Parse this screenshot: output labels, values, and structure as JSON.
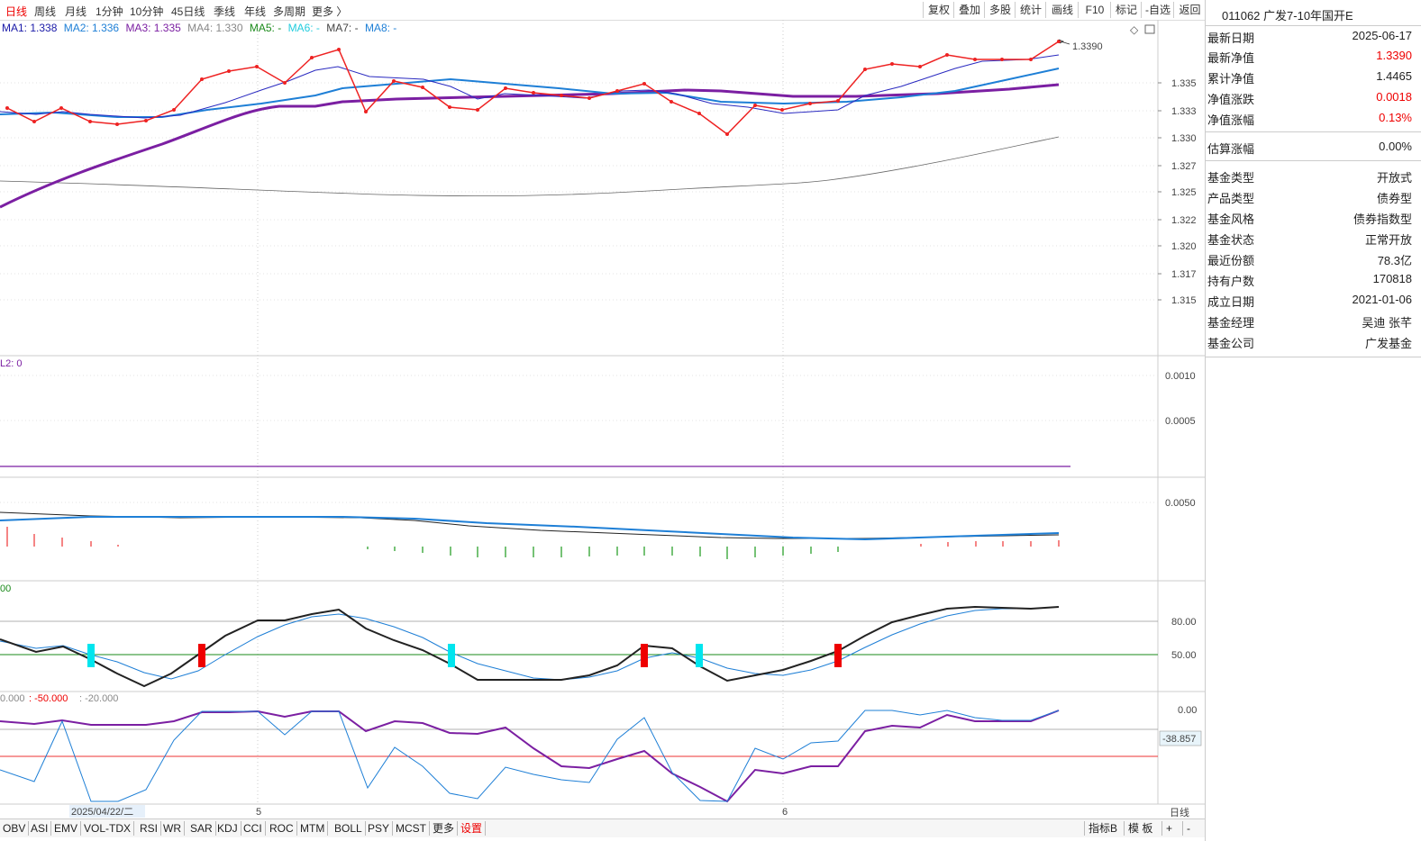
{
  "timeframes": [
    "日线",
    "周线",
    "月线",
    "1分钟",
    "10分钟",
    "45日线",
    "季线",
    "年线",
    "多周期",
    "更多 〉"
  ],
  "toolbar_right": [
    "复权",
    "叠加",
    "多股",
    "统计",
    "画线",
    "F10",
    "标记",
    "-自选",
    "返回"
  ],
  "ma_legend": [
    {
      "label": "MA1: 1.338",
      "color": "#1a1aa8"
    },
    {
      "label": "MA2: 1.336",
      "color": "#1e7fd6"
    },
    {
      "label": "MA3: 1.335",
      "color": "#7b1fa2"
    },
    {
      "label": "MA4: 1.330",
      "color": "#888888"
    },
    {
      "label": "MA5: -",
      "color": "#1a8a1a"
    },
    {
      "label": "MA6: -",
      "color": "#22ccdd"
    },
    {
      "label": "MA7: -",
      "color": "#444444"
    },
    {
      "label": "MA8: -",
      "color": "#1e7fd6"
    }
  ],
  "main_chart": {
    "last_label": "1.3390",
    "yticks": [
      "1.335",
      "1.333",
      "1.330",
      "1.327",
      "1.325",
      "1.322",
      "1.320",
      "1.317",
      "1.315"
    ]
  },
  "panel2": {
    "label": "L2: 0",
    "yticks": [
      "0.0010",
      "0.0005"
    ]
  },
  "panel3": {
    "yticks": [
      "0.0050"
    ]
  },
  "panel4": {
    "label": "00",
    "yticks": [
      "80.00",
      "50.00"
    ]
  },
  "panel5": {
    "label_a": "0.000",
    "label_b": ": -50.000",
    "label_c": ": -20.000",
    "yticks": [
      "0.00"
    ],
    "current": "-38.857"
  },
  "x_axis": {
    "date_label": "2025/04/22/二",
    "month_5": "5",
    "month_6": "6",
    "period": "日线"
  },
  "bottom_tabs": [
    "OBV",
    "ASI",
    "EMV",
    "VOL-TDX",
    "RSI",
    "WR",
    "SAR",
    "KDJ",
    "CCI",
    "ROC",
    "MTM",
    "BOLL",
    "PSY",
    "MCST",
    "更多",
    "设置"
  ],
  "bottom_right": [
    "指标B",
    "模 板",
    "+",
    "-"
  ],
  "fund": {
    "code_name": "011062 广发7-10年国开E",
    "rows": [
      {
        "k": "最新日期",
        "v": "2025-06-17",
        "red": false
      },
      {
        "k": "最新净值",
        "v": "1.3390",
        "red": true
      },
      {
        "k": "累计净值",
        "v": "1.4465",
        "red": false
      },
      {
        "k": "净值涨跌",
        "v": "0.0018",
        "red": true
      },
      {
        "k": "净值涨幅",
        "v": "0.13%",
        "red": true
      }
    ],
    "estimate": {
      "k": "估算涨幅",
      "v": "0.00%"
    },
    "info": [
      {
        "k": "基金类型",
        "v": "开放式"
      },
      {
        "k": "产品类型",
        "v": "债券型"
      },
      {
        "k": "基金风格",
        "v": "债券指数型"
      },
      {
        "k": "基金状态",
        "v": "正常开放"
      },
      {
        "k": "最近份额",
        "v": "78.3亿"
      },
      {
        "k": "持有户数",
        "v": "170818"
      },
      {
        "k": "成立日期",
        "v": "2021-01-06"
      },
      {
        "k": "基金经理",
        "v": "吴迪 张芊"
      },
      {
        "k": "基金公司",
        "v": "广发基金"
      }
    ]
  }
}
